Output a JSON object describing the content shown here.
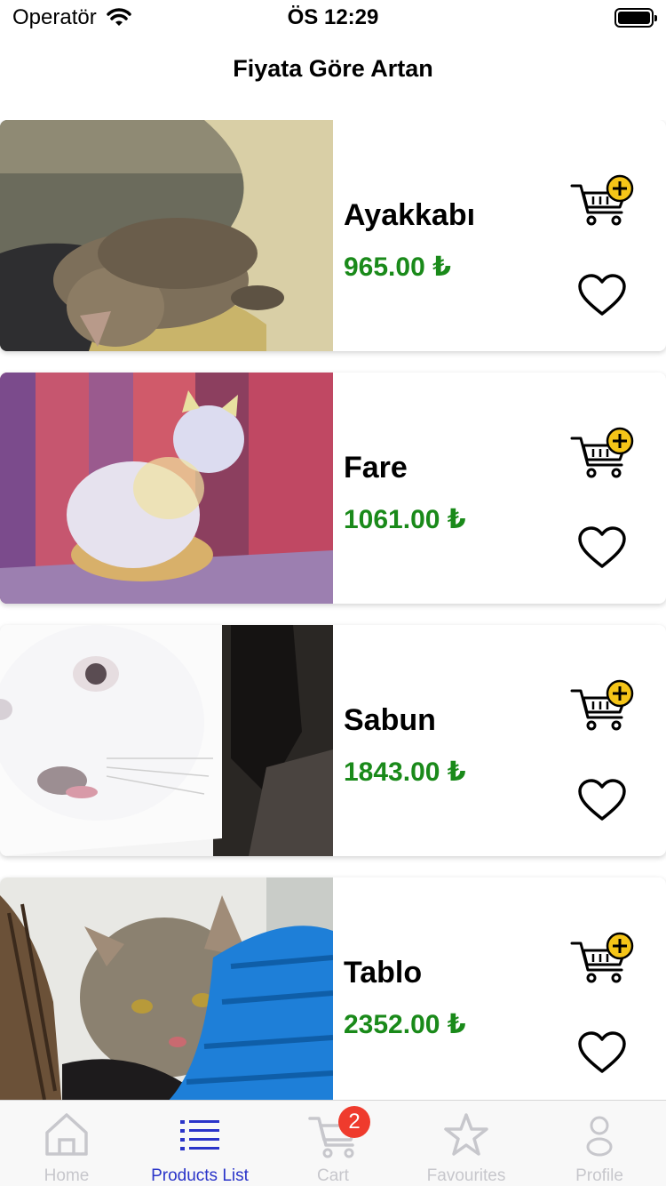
{
  "status": {
    "carrier": "Operatör",
    "time": "ÖS 12:29"
  },
  "header": {
    "title": "Fiyata Göre Artan"
  },
  "products": [
    {
      "name": "Ayakkabı",
      "price": "965.00 ₺"
    },
    {
      "name": "Fare",
      "price": "1061.00 ₺"
    },
    {
      "name": "Sabun",
      "price": "1843.00 ₺"
    },
    {
      "name": "Tablo",
      "price": "2352.00 ₺"
    }
  ],
  "tabs": [
    {
      "label": "Home",
      "icon": "home-icon"
    },
    {
      "label": "Products List",
      "icon": "list-icon"
    },
    {
      "label": "Cart",
      "icon": "cart-icon",
      "badge": "2"
    },
    {
      "label": "Favourites",
      "icon": "star-icon"
    },
    {
      "label": "Profile",
      "icon": "person-icon"
    }
  ],
  "colors": {
    "price": "#1a8a1a",
    "active_tab": "#2a34c9",
    "badge": "#ef3b2d",
    "inactive_tab": "#c7c7cc"
  }
}
